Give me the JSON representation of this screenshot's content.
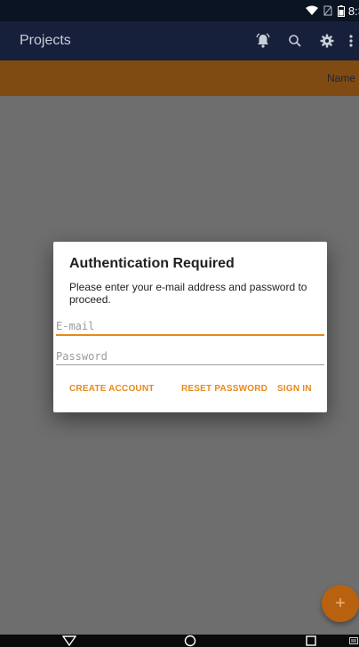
{
  "status_bar": {
    "time": "8:3",
    "icons": [
      "wifi-icon",
      "no-sim-icon",
      "battery-icon"
    ]
  },
  "app_bar": {
    "title": "Projects",
    "actions": [
      "notification-icon",
      "search-icon",
      "settings-icon",
      "more-vert-icon"
    ]
  },
  "table_header": {
    "name_label": "Name"
  },
  "dialog": {
    "title": "Authentication Required",
    "message": "Please enter your e-mail address and password to proceed.",
    "email_placeholder": "E-mail",
    "email_value": "",
    "password_placeholder": "Password",
    "password_value": "",
    "actions": {
      "create_account": "CREATE ACCOUNT",
      "reset_password": "RESET PASSWORD",
      "sign_in": "SIGN IN"
    }
  },
  "fab": {
    "icon": "add-icon",
    "label": "+"
  },
  "nav_bar": {
    "icons": [
      "back-icon",
      "home-icon",
      "recents-icon",
      "keyboard-icon"
    ]
  },
  "colors": {
    "status_bar": "#0a1422",
    "app_bar": "#16203a",
    "header_row": "#7f4b12",
    "scrim": "#6e6e6e",
    "accent": "#e8891a",
    "fab": "#b8620f"
  }
}
